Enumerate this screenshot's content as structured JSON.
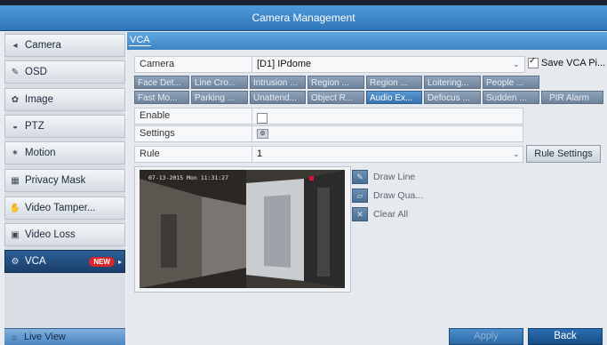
{
  "window": {
    "title": "Camera Management"
  },
  "sidebar": {
    "items": [
      {
        "label": "Camera",
        "icon": "camera-icon"
      },
      {
        "label": "OSD",
        "icon": "osd-icon"
      },
      {
        "label": "Image",
        "icon": "image-icon"
      },
      {
        "label": "PTZ",
        "icon": "ptz-icon"
      },
      {
        "label": "Motion",
        "icon": "motion-icon"
      },
      {
        "label": "Privacy Mask",
        "icon": "privacy-mask-icon"
      },
      {
        "label": "Video Tamper...",
        "icon": "video-tamper-icon"
      },
      {
        "label": "Video Loss",
        "icon": "video-loss-icon"
      },
      {
        "label": "VCA",
        "icon": "vca-icon",
        "badge": "NEW",
        "active": true
      }
    ],
    "live_view": "Live View"
  },
  "tab": {
    "label": "VCA"
  },
  "camera_row": {
    "label": "Camera",
    "value": "[D1] IPdome",
    "save_label": "Save VCA Pi...",
    "save_checked": true
  },
  "functions_row1": [
    "Face Det...",
    "Line Cro...",
    "Intrusion ...",
    "Region ...",
    "Region ...",
    "Loitering...",
    "People ..."
  ],
  "functions_row2": [
    "Fast Mo...",
    "Parking ...",
    "Unattend...",
    "Object R...",
    "Audio Ex...",
    "Defocus ...",
    "Sudden ...",
    "PIR Alarm"
  ],
  "selected_function": "Audio Ex...",
  "enable_row": {
    "label": "Enable",
    "checked": false
  },
  "settings_row": {
    "label": "Settings"
  },
  "rule_row": {
    "label": "Rule",
    "value": "1",
    "button": "Rule Settings"
  },
  "video": {
    "timestamp": "07-13-2015 Mon 11:31:27"
  },
  "tools": [
    {
      "label": "Draw Line",
      "icon": "draw-line-icon"
    },
    {
      "label": "Draw Qua...",
      "icon": "draw-quadrilateral-icon"
    },
    {
      "label": "Clear All",
      "icon": "clear-all-icon"
    }
  ],
  "footer": {
    "apply": "Apply",
    "back": "Back"
  }
}
